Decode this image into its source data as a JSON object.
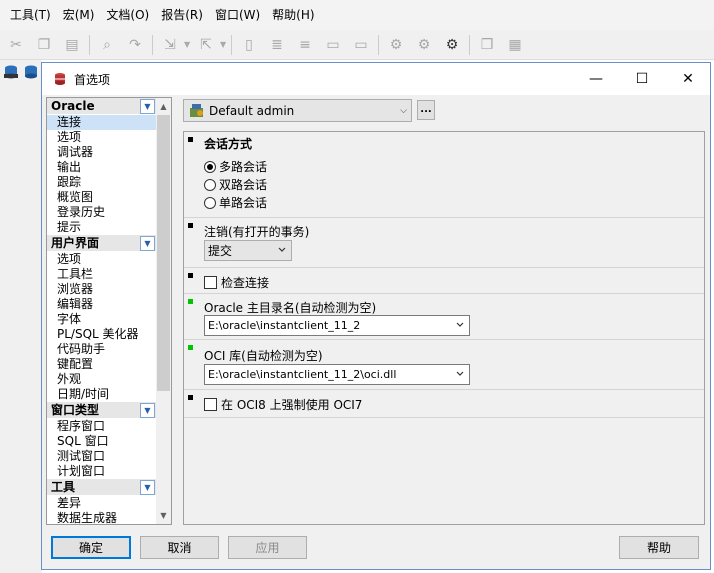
{
  "menubar": [
    "工具(T)",
    "宏(M)",
    "文档(O)",
    "报告(R)",
    "窗口(W)",
    "帮助(H)"
  ],
  "dialog": {
    "title": "首选项",
    "window_buttons": {
      "minimize": "—",
      "maximize": "☐",
      "close": "✕"
    }
  },
  "nav": {
    "categories": [
      {
        "label": "Oracle",
        "items": [
          "连接",
          "选项",
          "调试器",
          "输出",
          "跟踪",
          "概览图",
          "登录历史",
          "提示"
        ]
      },
      {
        "label": "用户界面",
        "items": [
          "选项",
          "工具栏",
          "浏览器",
          "编辑器",
          "字体",
          "PL/SQL 美化器",
          "代码助手",
          "键配置",
          "外观",
          "日期/时间"
        ]
      },
      {
        "label": "窗口类型",
        "items": [
          "程序窗口",
          "SQL 窗口",
          "测试窗口",
          "计划窗口"
        ]
      },
      {
        "label": "工具",
        "items": [
          "差异",
          "数据生成器"
        ]
      }
    ],
    "selected": "连接"
  },
  "profile": {
    "value": "Default admin",
    "more": "..."
  },
  "sections": {
    "session_mode": {
      "title": "会话方式",
      "options": [
        "多路会话",
        "双路会话",
        "单路会话"
      ],
      "selected": "多路会话"
    },
    "logoff": {
      "title": "注销(有打开的事务)",
      "value": "提交"
    },
    "check_connection": {
      "label": "检查连接",
      "checked": false
    },
    "oracle_home": {
      "title": "Oracle 主目录名(自动检测为空)",
      "value": "E:\\oracle\\instantclient_11_2"
    },
    "oci_library": {
      "title": "OCI 库(自动检测为空)",
      "value": "E:\\oracle\\instantclient_11_2\\oci.dll"
    },
    "force_oci7": {
      "label": "在 OCI8 上强制使用 OCI7",
      "checked": false
    }
  },
  "buttons": {
    "ok": "确定",
    "cancel": "取消",
    "apply": "应用",
    "help": "帮助"
  },
  "colors": {
    "selection": "#cde1f7",
    "marker_set": "#000000",
    "marker_default": "#00c400",
    "accent": "#0078d7"
  }
}
